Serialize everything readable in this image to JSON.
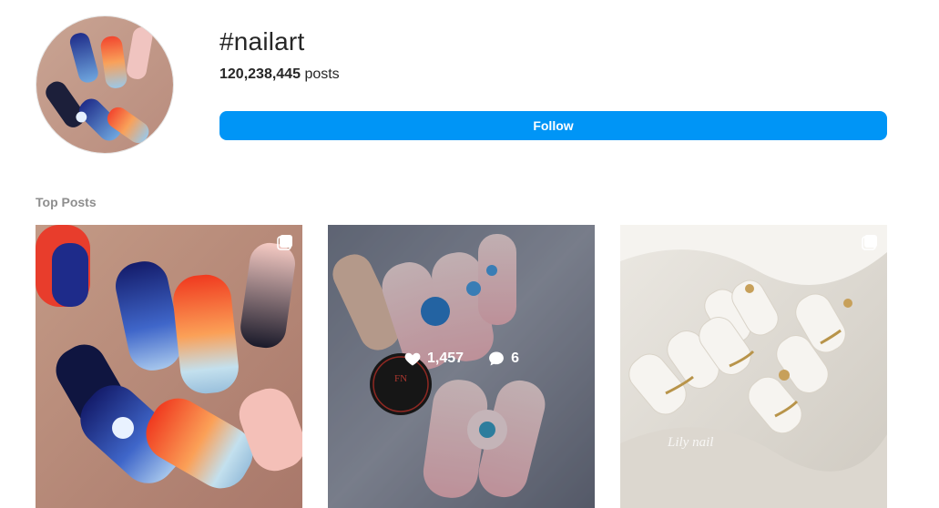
{
  "hashtag": {
    "title": "#nailart",
    "post_count": "120,238,445",
    "post_count_suffix": "posts",
    "follow_label": "Follow"
  },
  "top_posts": {
    "label": "Top Posts",
    "items": [
      {
        "icon": "multiple-photos-icon"
      },
      {
        "likes": "1,457",
        "comments": "6",
        "overlay_text": "NAILS ART"
      },
      {
        "icon": "multiple-photos-icon",
        "watermark": "Lily nail"
      }
    ]
  },
  "colors": {
    "accent": "#0095f6",
    "muted_text": "#8e8e8e",
    "primary_text": "#262626"
  }
}
